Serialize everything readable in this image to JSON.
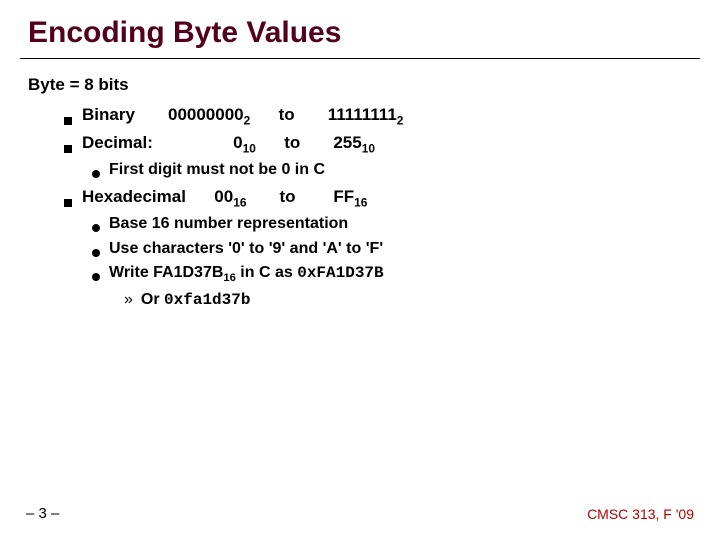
{
  "title": "Encoding Byte Values",
  "heading": "Byte = 8 bits",
  "lines": {
    "binary": {
      "label": "Binary",
      "from": "00000000",
      "from_sub": "2",
      "to_word": "to",
      "to": "11111111",
      "to_sub": "2"
    },
    "decimal": {
      "label": "Decimal:",
      "from": "0",
      "from_sub": "10",
      "to_word": "to",
      "to": "255",
      "to_sub": "10"
    },
    "decimal_note": "First digit must not be 0 in C",
    "hex": {
      "label": "Hexadecimal",
      "from": "00",
      "from_sub": "16",
      "to_word": "to",
      "to": "FF",
      "to_sub": "16"
    },
    "hex_notes": {
      "a": "Base 16 number representation",
      "b_prefix": "Use characters ",
      "b_q0": "'0'",
      "b_mid": " to ",
      "b_q9": "'9'",
      "b_and": " and ",
      "b_qA": "'A'",
      "b_mid2": " to ",
      "b_qF": "'F'",
      "c_prefix": "Write ",
      "c_val": "FA1D37B",
      "c_val_sub": "16",
      "c_mid": " in C as ",
      "c_code": "0xFA1D37B",
      "d_prefix": "Or  ",
      "d_code": "0xfa1d37b"
    }
  },
  "footer": {
    "left": "– 3 –",
    "right": "CMSC 313, F '09"
  }
}
